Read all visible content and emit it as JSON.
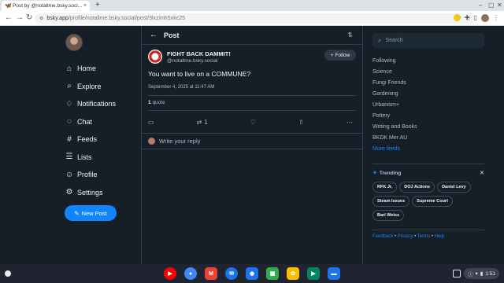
{
  "browser": {
    "tab_title": "Post by @notallme.bsky.soci...",
    "tab_close": "×",
    "new_tab": "+",
    "url_host": "bsky.app",
    "url_path": "/profile/notallme.bsky.social/post/3lxzimh5xkc25"
  },
  "nav": {
    "items": [
      {
        "label": "Home",
        "icon": "house-icon"
      },
      {
        "label": "Explore",
        "icon": "search-icon"
      },
      {
        "label": "Notifications",
        "icon": "bell-icon"
      },
      {
        "label": "Chat",
        "icon": "chat-icon"
      },
      {
        "label": "Feeds",
        "icon": "hash-icon"
      },
      {
        "label": "Lists",
        "icon": "list-icon"
      },
      {
        "label": "Profile",
        "icon": "user-icon"
      },
      {
        "label": "Settings",
        "icon": "gear-icon"
      }
    ],
    "new_post": "New Post"
  },
  "main": {
    "header_title": "Post",
    "post": {
      "author_name": "FIGHT BACK DAMMIT!",
      "author_handle": "@notallme.bsky.social",
      "follow_label": "Follow",
      "text": "You want to live on a COMMUNE?",
      "timestamp": "September 4, 2025 at 11:47 AM",
      "quote_count": "1",
      "quote_label": "quote",
      "repost_count": "1"
    },
    "reply_placeholder": "Write your reply"
  },
  "right": {
    "search_placeholder": "Search",
    "feeds": [
      "Following",
      "Science",
      "Fungi Friends",
      "Gardening",
      "Urbanism+",
      "Pottery",
      "Writing and Books",
      "BKDK Mer AU"
    ],
    "more_feeds": "More feeds",
    "trending_title": "Trending",
    "trending": [
      "RFK Jr.",
      "DOJ Actions",
      "Daniel Levy",
      "Steam Issues",
      "Supreme Court",
      "Bari Weiss"
    ],
    "footer": {
      "feedback": "Feedback",
      "privacy": "Privacy",
      "terms": "Terms",
      "help": "Help",
      "sep": " • "
    }
  },
  "shelf": {
    "clock": "1:51",
    "apps": [
      {
        "name": "youtube",
        "color": "#ff0000",
        "glyph": "▶"
      },
      {
        "name": "chrome",
        "color": "#4285f4",
        "glyph": "●"
      },
      {
        "name": "gmail",
        "color": "#ea4335",
        "glyph": "M"
      },
      {
        "name": "messages",
        "color": "#1a73e8",
        "glyph": "✉"
      },
      {
        "name": "camera",
        "color": "#1a73e8",
        "glyph": "◉"
      },
      {
        "name": "sheets",
        "color": "#34a853",
        "glyph": "▦"
      },
      {
        "name": "photos",
        "color": "#fbbc04",
        "glyph": "✿"
      },
      {
        "name": "play-store",
        "color": "#01875f",
        "glyph": "▶"
      },
      {
        "name": "files",
        "color": "#1a73e8",
        "glyph": "▬"
      }
    ]
  },
  "colors": {
    "accent": "#1185fe",
    "bg": "#161e27",
    "border": "#2e4052",
    "muted": "#aebbc9"
  }
}
